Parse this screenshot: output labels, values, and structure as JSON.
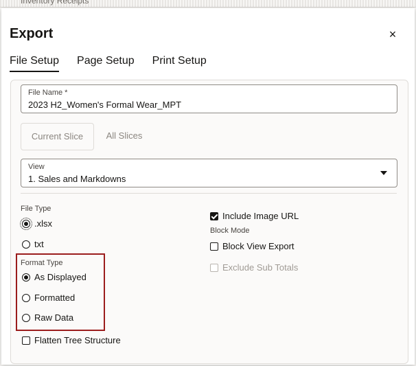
{
  "background": {
    "title": "Inventory Receipts"
  },
  "dialog": {
    "title": "Export",
    "close_icon": "×"
  },
  "tabs": [
    {
      "label": "File Setup",
      "active": true
    },
    {
      "label": "Page Setup",
      "active": false
    },
    {
      "label": "Print Setup",
      "active": false
    }
  ],
  "file_name": {
    "label": "File Name *",
    "value": "2023 H2_Women's Formal Wear_MPT"
  },
  "slice": {
    "current_label": "Current Slice",
    "all_label": "All Slices",
    "selected": "Current Slice"
  },
  "view": {
    "label": "View",
    "value": "1. Sales and Markdowns"
  },
  "file_type": {
    "label": "File Type",
    "options": [
      ".xlsx",
      "txt"
    ],
    "selected": ".xlsx"
  },
  "format_type": {
    "label": "Format Type",
    "options": [
      "As Displayed",
      "Formatted",
      "Raw Data"
    ],
    "selected": "As Displayed"
  },
  "flatten_tree": {
    "label": "Flatten Tree Structure",
    "checked": false
  },
  "include_image_url": {
    "label": "Include Image URL",
    "checked": true
  },
  "block_mode": {
    "label": "Block Mode",
    "block_view_export": {
      "label": "Block View Export",
      "checked": false
    }
  },
  "exclude_sub_totals": {
    "label": "Exclude Sub Totals",
    "checked": false,
    "disabled": true
  },
  "colors": {
    "highlight": "#9b1c1c",
    "text": "#161513"
  }
}
